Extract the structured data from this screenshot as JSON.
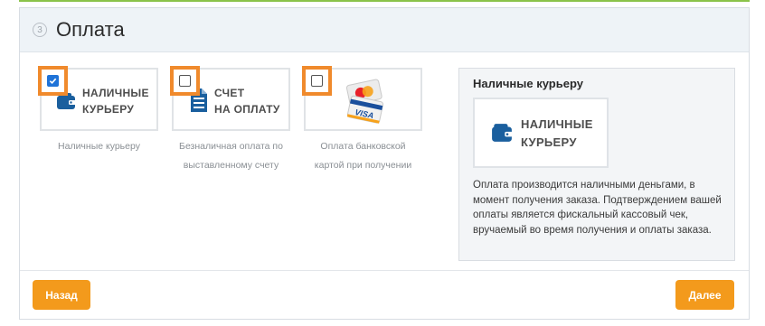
{
  "header": {
    "step": "3",
    "title": "Оплата"
  },
  "options": [
    {
      "logo_line1": "НАЛИЧНЫЕ",
      "logo_line2": "КУРЬЕРУ",
      "caption_line1": "Наличные курьеру",
      "caption_line2": "",
      "checked": true
    },
    {
      "logo_line1": "СЧЕТ",
      "logo_line2": "НА ОПЛАТУ",
      "caption_line1": "Безналичная оплата по",
      "caption_line2": "выставленному счету",
      "checked": false
    },
    {
      "logo_line1": "",
      "logo_line2": "",
      "caption_line1": "Оплата банковской",
      "caption_line2": "картой при получении",
      "checked": false
    }
  ],
  "detail": {
    "title": "Наличные курьеру",
    "logo_line1": "НАЛИЧНЫЕ",
    "logo_line2": "КУРЬЕРУ",
    "description": "Оплата производится наличными деньгами, в момент получения заказа. Подтверждением вашей оплаты является фискальный кассовый чек, вручаемый во время получения и оплаты заказа."
  },
  "buttons": {
    "back": "Назад",
    "next": "Далее"
  },
  "colors": {
    "accent": "#f39a1c",
    "checkbox_frame": "#f08a2c",
    "icon_blue": "#1a5f9e",
    "header_bg": "#eef3f7"
  },
  "icons": {
    "cash": "wallet-icon",
    "invoice": "document-icon",
    "card": "credit-cards-icon"
  }
}
